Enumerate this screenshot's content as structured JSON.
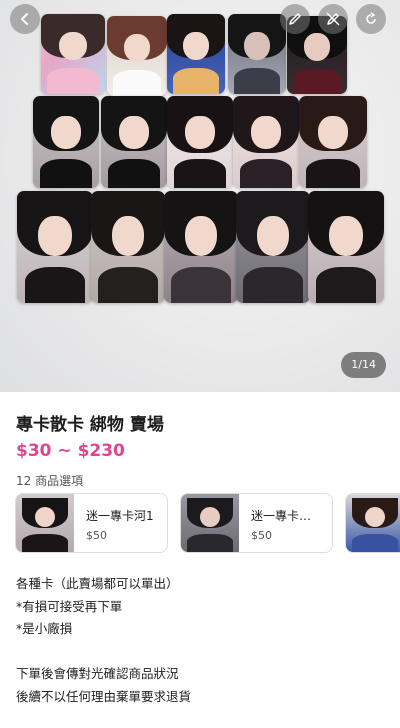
{
  "nav": {
    "back_icon": "chevron-left-icon",
    "edit_icon": "pencil-icon",
    "edit2_icon": "pencil-slash-icon",
    "share_icon": "share-icon"
  },
  "gallery": {
    "current": 1,
    "total": 14,
    "counter_text": "1/14"
  },
  "product": {
    "title": "專卡散卡 綁物 賣場",
    "price_range": "$30 ~ $230",
    "price_color": "#e0458f",
    "option_count_text": "12 商品選項"
  },
  "options": [
    {
      "name": "迷一專卡河1",
      "price": "$50"
    },
    {
      "name": "迷一專卡…",
      "price": "$50"
    }
  ],
  "description": [
    "各種卡（此賣場都可以單出）",
    "*有損可接受再下單",
    "*是小廠損",
    "",
    "下單後會傳對光確認商品狀況",
    "後續不以任何理由棄單要求退貨"
  ]
}
